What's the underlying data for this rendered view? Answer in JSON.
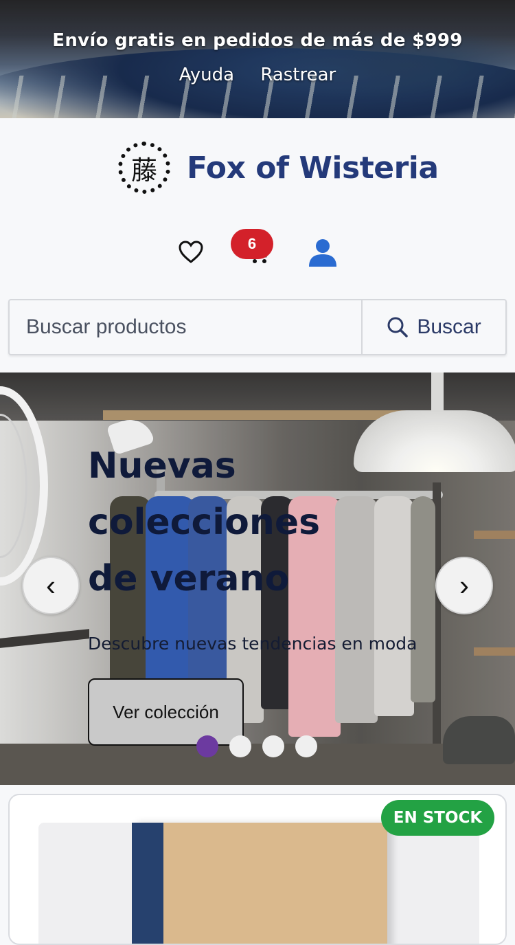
{
  "topbar": {
    "shipping_message": "Envío gratis en pedidos de más de $999",
    "links": [
      "Ayuda",
      "Rastrear"
    ]
  },
  "brand": {
    "name": "Fox of Wisteria",
    "logo_kanji": "藤"
  },
  "header_icons": {
    "wishlist": "heart-icon",
    "cart": "cart-icon",
    "cart_count": "6",
    "account": "user-icon"
  },
  "search": {
    "placeholder": "Buscar productos",
    "button_label": "Buscar"
  },
  "hero": {
    "title": "Nuevas colecciones de verano",
    "subtitle": "Descubre nuevas tendencias en moda",
    "cta_label": "Ver colección",
    "prev_label": "‹",
    "next_label": "›",
    "slide_count": 4,
    "active_slide": 1
  },
  "product": {
    "stock_badge": "EN STOCK"
  },
  "colors": {
    "brand_blue": "#243a7a",
    "badge_red": "#d3212a",
    "active_dot": "#6c3aa0",
    "stock_green": "#23a244"
  }
}
